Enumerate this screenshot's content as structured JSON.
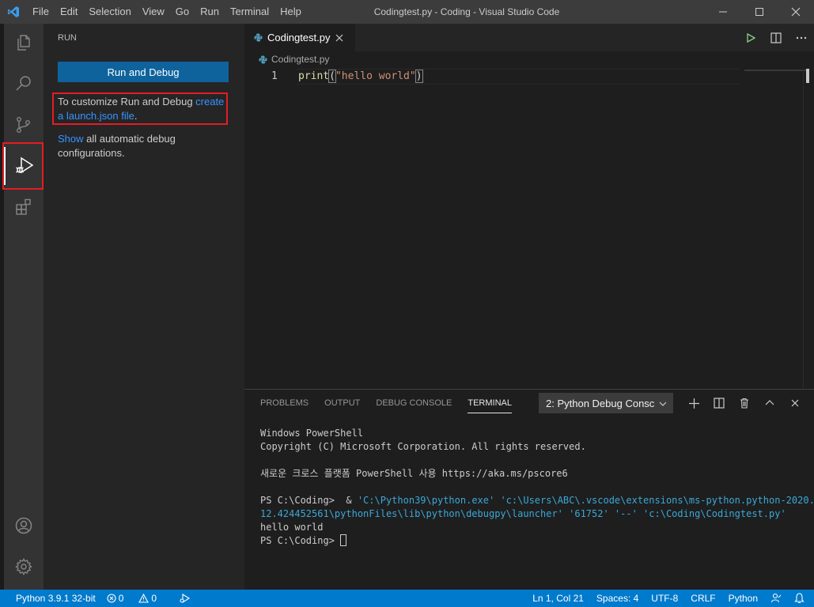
{
  "titlebar": {
    "menu": [
      "File",
      "Edit",
      "Selection",
      "View",
      "Go",
      "Run",
      "Terminal",
      "Help"
    ],
    "title": "Codingtest.py - Coding - Visual Studio Code"
  },
  "activity_bar": {
    "items": [
      "explorer-icon",
      "search-icon",
      "source-control-icon",
      "run-debug-icon",
      "extensions-icon"
    ],
    "bottom": [
      "account-icon",
      "settings-gear-icon"
    ]
  },
  "sidebar": {
    "header": "RUN",
    "run_button": "Run and Debug",
    "customize_text": "To customize Run and Debug ",
    "customize_link": "create a launch.json file",
    "customize_end": ".",
    "show_link": "Show",
    "show_text": " all automatic debug configurations."
  },
  "editor": {
    "tab_label": "Codingtest.py",
    "breadcrumb": "Codingtest.py",
    "line_number": "1",
    "code": {
      "fn": "print",
      "open": "(",
      "str": "\"hello world\"",
      "close": ")"
    }
  },
  "panel": {
    "tabs": [
      "PROBLEMS",
      "OUTPUT",
      "DEBUG CONSOLE",
      "TERMINAL"
    ],
    "active_tab": "TERMINAL",
    "terminal_select": "2: Python Debug Consc",
    "terminal": {
      "line1": "Windows PowerShell",
      "line2": "Copyright (C) Microsoft Corporation. All rights reserved.",
      "line3": "새로운 크로스 플랫폼 PowerShell 사용 https://aka.ms/pscore6",
      "prompt1": "PS C:\\Coding>  & ",
      "cmd_a": "'C:\\Python39\\python.exe' 'c:\\Users\\ABC\\.vscode\\extensions\\ms-python.python-2020.",
      "cmd_b": "12.424452561\\pythonFiles\\lib\\python\\debugpy\\launcher' '61752' '--' 'c:\\Coding\\Codingtest.py'",
      "output": "hello world",
      "prompt2": "PS C:\\Coding> "
    }
  },
  "statusbar": {
    "python": "Python 3.9.1 32-bit",
    "errors": "0",
    "warnings": "0",
    "position": "Ln 1, Col 21",
    "spaces": "Spaces: 4",
    "encoding": "UTF-8",
    "eol": "CRLF",
    "language": "Python"
  },
  "colors": {
    "accent": "#007acc",
    "button": "#0e639c",
    "link": "#3794ff",
    "highlight_box": "#e51c23"
  }
}
